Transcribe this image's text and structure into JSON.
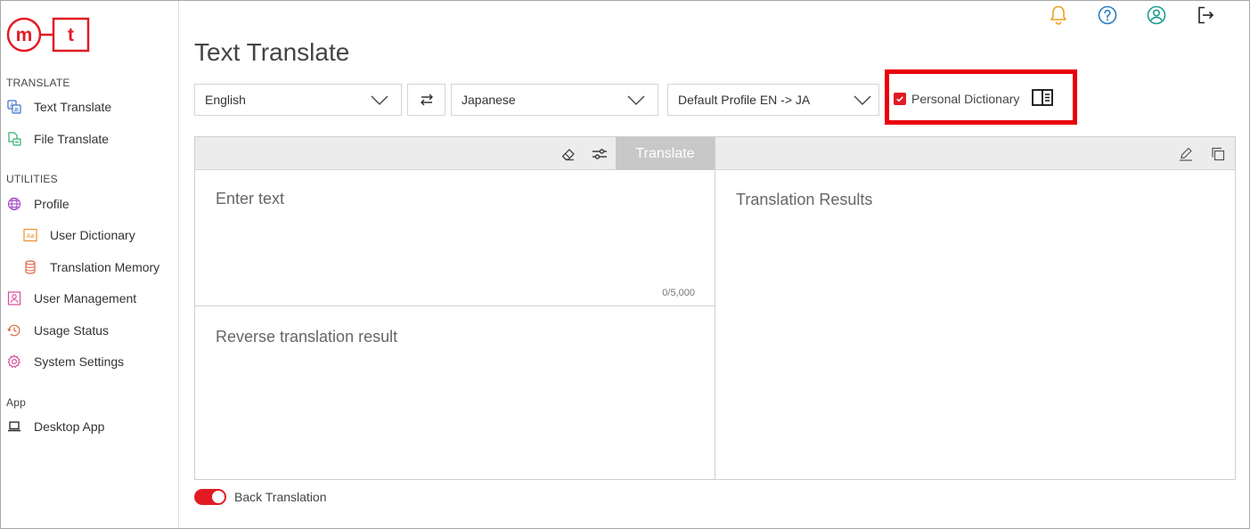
{
  "logo": {
    "left_letter": "m",
    "right_letter": "t",
    "color": "#e21b23"
  },
  "sidebar": {
    "translate_section": "TRANSLATE",
    "text_translate": "Text Translate",
    "file_translate": "File Translate",
    "utilities_section": "UTILITIES",
    "profile": "Profile",
    "user_dictionary": "User Dictionary",
    "translation_memory": "Translation Memory",
    "user_management": "User Management",
    "usage_status": "Usage Status",
    "system_settings": "System Settings",
    "app_section": "App",
    "desktop_app": "Desktop App"
  },
  "header_icons": {
    "notifications": "bell-icon",
    "help": "help-circle-icon",
    "account": "user-circle-icon",
    "logout": "logout-icon"
  },
  "page_title": "Text Translate",
  "controls": {
    "source_language": "English",
    "target_language": "Japanese",
    "profile": "Default Profile EN -> JA",
    "personal_dictionary_label": "Personal Dictionary",
    "personal_dictionary_checked": true
  },
  "source_panel": {
    "translate_button": "Translate",
    "input_placeholder": "Enter text",
    "char_counter": "0/5,000",
    "reverse_placeholder": "Reverse translation result"
  },
  "target_panel": {
    "results_placeholder": "Translation Results"
  },
  "back_translation": {
    "label": "Back Translation",
    "enabled": true
  },
  "colors": {
    "accent": "#e21b23",
    "highlight_box": "#e8000b",
    "bell": "#f0a020",
    "help": "#2a7bc4",
    "account": "#1a9e8c"
  }
}
